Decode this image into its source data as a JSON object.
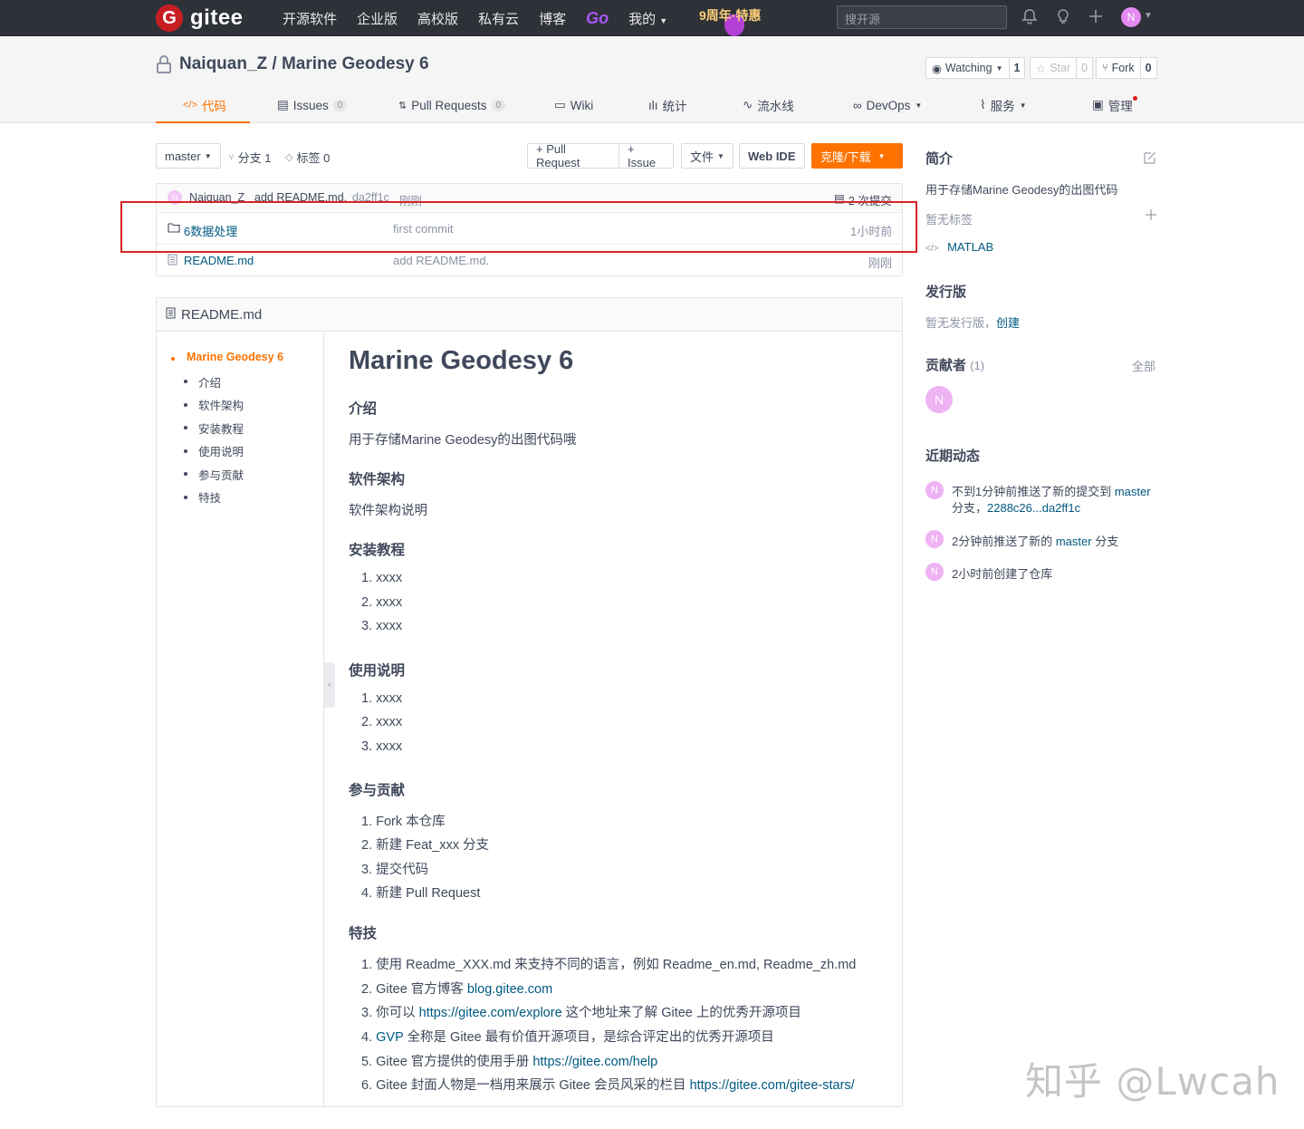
{
  "topbar": {
    "logo_mark": "G",
    "logo_text": "gitee",
    "nav": [
      "开源软件",
      "企业版",
      "高校版",
      "私有云",
      "博客"
    ],
    "go": "Go",
    "mine": "我的",
    "promo": "9周年·特惠",
    "search_placeholder": "搜开源",
    "avatar": "N"
  },
  "repo": {
    "owner": "Naiquan_Z",
    "separator": " / ",
    "name": "Marine Geodesy 6",
    "watching": "Watching",
    "watching_count": "1",
    "star": "Star",
    "star_count": "0",
    "fork": "Fork",
    "fork_count": "0"
  },
  "tabs": {
    "code": "代码",
    "issues": "Issues",
    "issues_count": "0",
    "pulls": "Pull Requests",
    "pulls_count": "0",
    "wiki": "Wiki",
    "stats": "统计",
    "pipeline": "流水线",
    "devops": "DevOps",
    "services": "服务",
    "manage": "管理"
  },
  "toolbar": {
    "branch": "master",
    "branches": "分支 1",
    "tags": "标签 0",
    "pull_request": "+ Pull Request",
    "issue": "+ Issue",
    "files": "文件",
    "web_ide": "Web IDE",
    "clone": "克隆/下载"
  },
  "commit": {
    "avatar": "N",
    "author": "Naiquan_Z",
    "message": "add README.md.",
    "hash": "da2ff1c",
    "time": "刚刚",
    "count": "2 次提交"
  },
  "files": [
    {
      "name": "6数据处理",
      "message": "first commit",
      "time": "1小时前"
    },
    {
      "name": "README.md",
      "message": "add README.md.",
      "time": "刚刚"
    }
  ],
  "readme": {
    "filename": "README.md",
    "toc": [
      "Marine Geodesy 6",
      "介绍",
      "软件架构",
      "安装教程",
      "使用说明",
      "参与贡献",
      "特技"
    ],
    "h1": "Marine Geodesy 6",
    "intro_h": "介绍",
    "intro_p": "用于存储Marine Geodesy的出图代码哦",
    "arch_h": "软件架构",
    "arch_p": "软件架构说明",
    "install_h": "安装教程",
    "install": [
      "1. xxxx",
      "2. xxxx",
      "3. xxxx"
    ],
    "usage_h": "使用说明",
    "usage": [
      "1. xxxx",
      "2. xxxx",
      "3. xxxx"
    ],
    "contrib_h": "参与贡献",
    "contrib": [
      "1. Fork 本仓库",
      "2. 新建 Feat_xxx 分支",
      "3. 提交代码",
      "4. 新建 Pull Request"
    ],
    "tips_h": "特技",
    "tip1": "1. 使用 Readme_XXX.md 来支持不同的语言，例如 Readme_en.md, Readme_zh.md",
    "tip2_pre": "2. Gitee 官方博客 ",
    "tip2_link": "blog.gitee.com",
    "tip3_pre": "3. 你可以 ",
    "tip3_link": "https://gitee.com/explore",
    "tip3_post": " 这个地址来了解 Gitee 上的优秀开源项目",
    "tip4_pre": "4. ",
    "tip4_link": "GVP",
    "tip4_post": " 全称是 Gitee 最有价值开源项目，是综合评定出的优秀开源项目",
    "tip5_pre": "5. Gitee 官方提供的使用手册 ",
    "tip5_link": "https://gitee.com/help",
    "tip6_pre": "6. Gitee 封面人物是一档用来展示 Gitee 会员风采的栏目 ",
    "tip6_link": "https://gitee.com/gitee-stars/"
  },
  "sidebar": {
    "intro_title": "简介",
    "intro_text": "用于存储Marine Geodesy的出图代码",
    "no_tags": "暂无标签",
    "language": "MATLAB",
    "release_title": "发行版",
    "no_release": "暂无发行版，",
    "create": "创建",
    "contrib_title": "贡献者",
    "contrib_count": "(1)",
    "all": "全部",
    "contributor_avatar": "N",
    "activity_title": "近期动态",
    "act1_pre": "不到1分钟前推送了新的提交到 ",
    "act1_branch": "master",
    "act1_line2_pre": "分支，",
    "act1_range": "2288c26...da2ff1c",
    "act2_pre": "2分钟前推送了新的 ",
    "act2_branch": "master",
    "act2_post": " 分支",
    "act3": "2小时前创建了仓库"
  },
  "watermark": "知乎 @Lwcah",
  "colors": {
    "accent": "#fe7300",
    "link": "#005980",
    "highlight_box": "#d52424",
    "topbar": "#2e3238"
  }
}
